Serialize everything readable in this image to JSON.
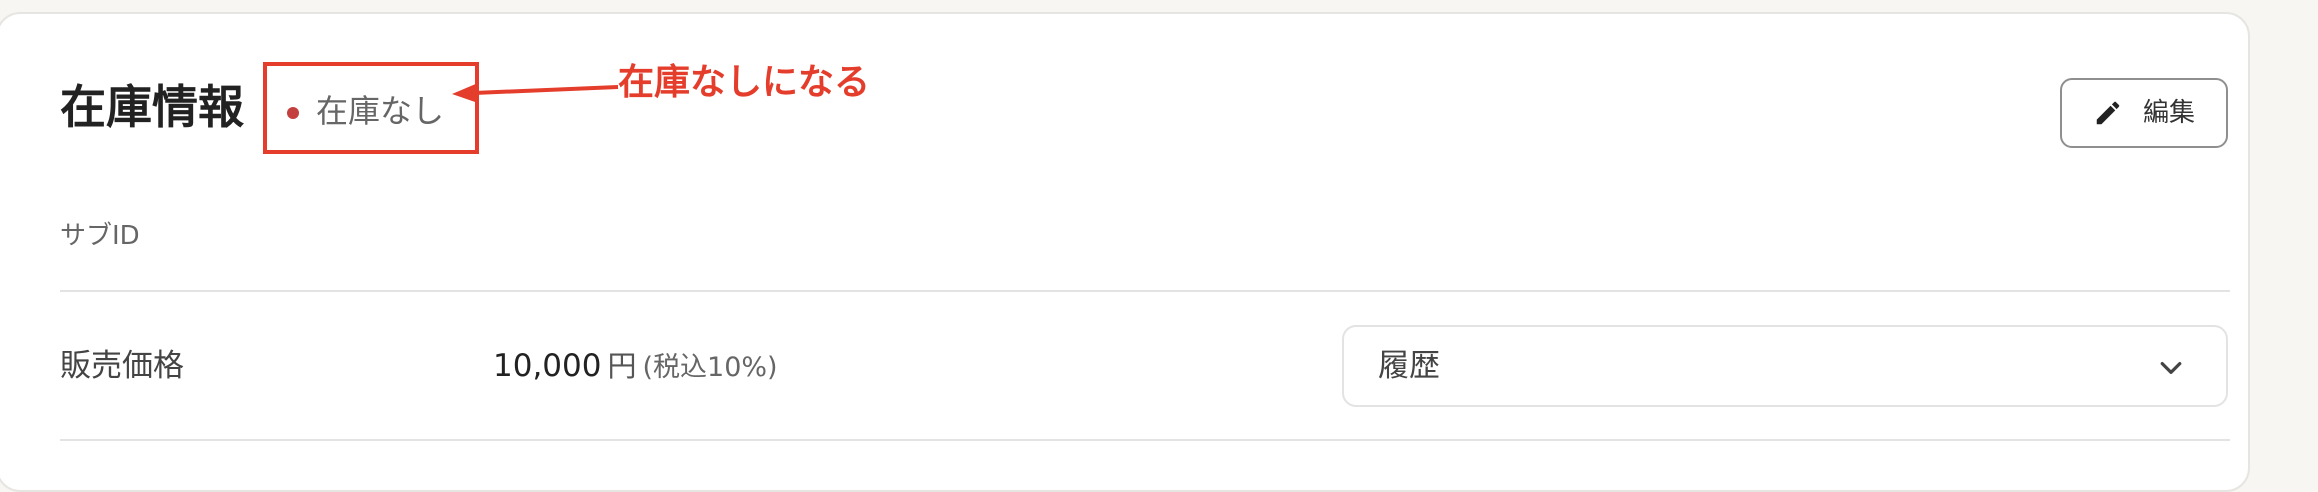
{
  "section": {
    "title": "在庫情報",
    "status": {
      "label": "在庫なし",
      "dot_color": "#c4403f"
    },
    "annotation": {
      "text": "在庫なしになる",
      "color": "#e53d2b"
    },
    "edit_button": {
      "label": "編集",
      "icon": "pencil-icon"
    }
  },
  "fields": {
    "subid_label": "サブID",
    "price_label": "販売価格",
    "price_value": "10,000",
    "price_unit": "円",
    "price_tax": "(税込10%)"
  },
  "history": {
    "label": "履歴",
    "icon": "chevron-down-icon"
  }
}
